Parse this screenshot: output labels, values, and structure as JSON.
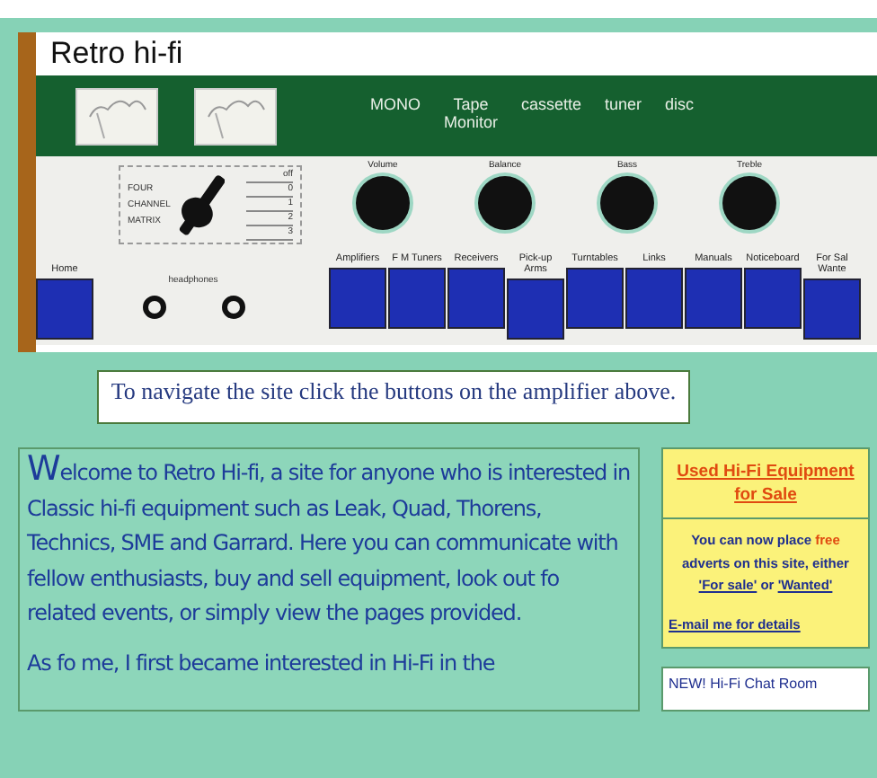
{
  "site_title": "Retro hi-fi",
  "band_labels": [
    "MONO",
    "Tape Monitor",
    "cassette",
    "tuner",
    "disc"
  ],
  "switch": {
    "labels": [
      "FOUR",
      "CHANNEL",
      "MATRIX"
    ],
    "scale": [
      "off",
      "0",
      "1",
      "2",
      "3"
    ]
  },
  "knobs": [
    "Volume",
    "Balance",
    "Bass",
    "Treble"
  ],
  "headphones_label": "headphones",
  "home": {
    "label": "Home"
  },
  "nav": [
    {
      "label": "Amplifiers"
    },
    {
      "label": "F M Tuners"
    },
    {
      "label": "Receivers"
    },
    {
      "label": "Pick-up Arms"
    },
    {
      "label": "Turntables"
    },
    {
      "label": "Links"
    },
    {
      "label": "Manuals"
    },
    {
      "label": "Noticeboard"
    },
    {
      "label": "For Sal Wante"
    }
  ],
  "notice": "To navigate the site click the buttons on the amplifier above.",
  "intro": [
    "Welcome to Retro Hi-fi, a site for anyone who is interested in Classic hi-fi equipment such as Leak, Quad, Thorens, Technics, SME and Garrard.  Here you can communicate with fellow enthusiasts, buy and sell equipment, look out fo  related events, or simply view the pages provided.",
    "As fo  me, I first became interested in Hi-Fi in the"
  ],
  "sidebar": {
    "heading": "Used Hi-Fi Equipment for Sale",
    "advert": [
      {
        "kind": "plain",
        "text": "You can now place "
      },
      {
        "kind": "highlight",
        "text": "free"
      },
      {
        "kind": "plain",
        "text": " adverts on this site, either "
      },
      {
        "kind": "link",
        "text": "'For sale'"
      },
      {
        "kind": "plain",
        "text": " or "
      },
      {
        "kind": "link",
        "text": "'Wanted'"
      }
    ],
    "email": "E-mail me for details"
  },
  "chat": "NEW!  Hi-Fi Chat Room"
}
